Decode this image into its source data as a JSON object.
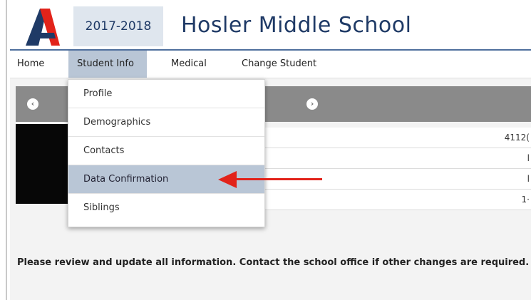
{
  "header": {
    "logo_letter": "A",
    "year": "2017-2018",
    "school_name": "Hosler Middle School"
  },
  "nav": {
    "items": [
      {
        "label": "Home"
      },
      {
        "label": "Student Info",
        "active": true
      },
      {
        "label": "Medical"
      },
      {
        "label": "Change Student"
      }
    ]
  },
  "menu": {
    "items": [
      {
        "label": "Profile"
      },
      {
        "label": "Demographics"
      },
      {
        "label": "Contacts"
      },
      {
        "label": "Data Confirmation",
        "highlighted": true
      },
      {
        "label": "Siblings"
      }
    ]
  },
  "student_panel": {
    "prev_icon": "chevron-left-icon",
    "next_icon": "chevron-right-icon",
    "rows": [
      {
        "value": "4112("
      },
      {
        "value": "l"
      },
      {
        "value": "l"
      },
      {
        "value": "1·"
      }
    ]
  },
  "notice": {
    "text": "Please review and update all information. Contact the school office if other changes are required."
  },
  "colors": {
    "brand_blue": "#1f3a66",
    "accent_red": "#e2231a",
    "nav_active": "#b9c6d6"
  }
}
